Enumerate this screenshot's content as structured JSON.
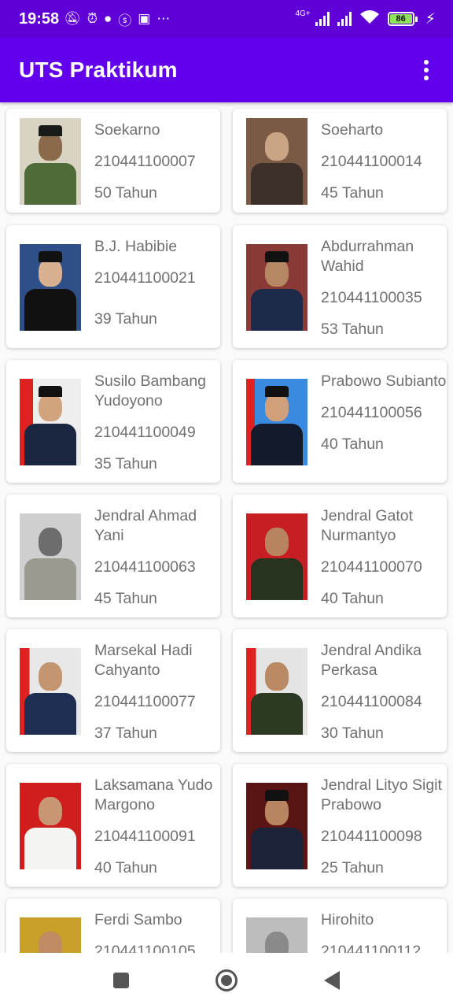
{
  "status_bar": {
    "time": "19:58",
    "left_icons": [
      "mute-icon",
      "alarm-icon",
      "whatsapp-icon",
      "s-icon",
      "gallery-icon",
      "more-icon"
    ],
    "network_label": "4G+",
    "battery_level": "86",
    "icons_right": [
      "signal-icon",
      "signal-icon",
      "wifi-icon",
      "battery-icon",
      "charging-icon"
    ]
  },
  "app_bar": {
    "title": "UTS Praktikum",
    "menu_icon": "more-vert-icon"
  },
  "colors": {
    "status_bar": "#5e00d6",
    "app_bar": "#6200ee",
    "card": "#ffffff",
    "text": "#707070",
    "background": "#fafafa"
  },
  "items": [
    {
      "name": "Soekarno",
      "nim": "210441100007",
      "age": "50 Tahun"
    },
    {
      "name": "Soeharto",
      "nim": "210441100014",
      "age": "45 Tahun"
    },
    {
      "name": "B.J. Habibie",
      "nim": "210441100021",
      "age": "39 Tahun"
    },
    {
      "name": "Abdurrahman Wahid",
      "nim": "210441100035",
      "age": "53 Tahun"
    },
    {
      "name": "Susilo Bambang Yudoyono",
      "nim": "210441100049",
      "age": "35 Tahun"
    },
    {
      "name": "Prabowo Subianto",
      "nim": "210441100056",
      "age": "40 Tahun"
    },
    {
      "name": "Jendral Ahmad Yani",
      "nim": "210441100063",
      "age": "45 Tahun"
    },
    {
      "name": "Jendral Gatot Nurmantyo",
      "nim": "210441100070",
      "age": "40 Tahun"
    },
    {
      "name": "Marsekal Hadi Cahyanto",
      "nim": "210441100077",
      "age": "37 Tahun"
    },
    {
      "name": "Jendral Andika Perkasa",
      "nim": "210441100084",
      "age": "30 Tahun"
    },
    {
      "name": "Laksamana Yudo Margono",
      "nim": "210441100091",
      "age": "40 Tahun"
    },
    {
      "name": "Jendral Lityo Sigit Prabowo",
      "nim": "210441100098",
      "age": "25 Tahun"
    },
    {
      "name": "Ferdi Sambo",
      "nim": "210441100105",
      "age": ""
    },
    {
      "name": "Hirohito",
      "nim": "210441100112",
      "age": ""
    }
  ],
  "nav_bar": {
    "icons": [
      "recents-icon",
      "home-icon",
      "back-icon"
    ]
  }
}
